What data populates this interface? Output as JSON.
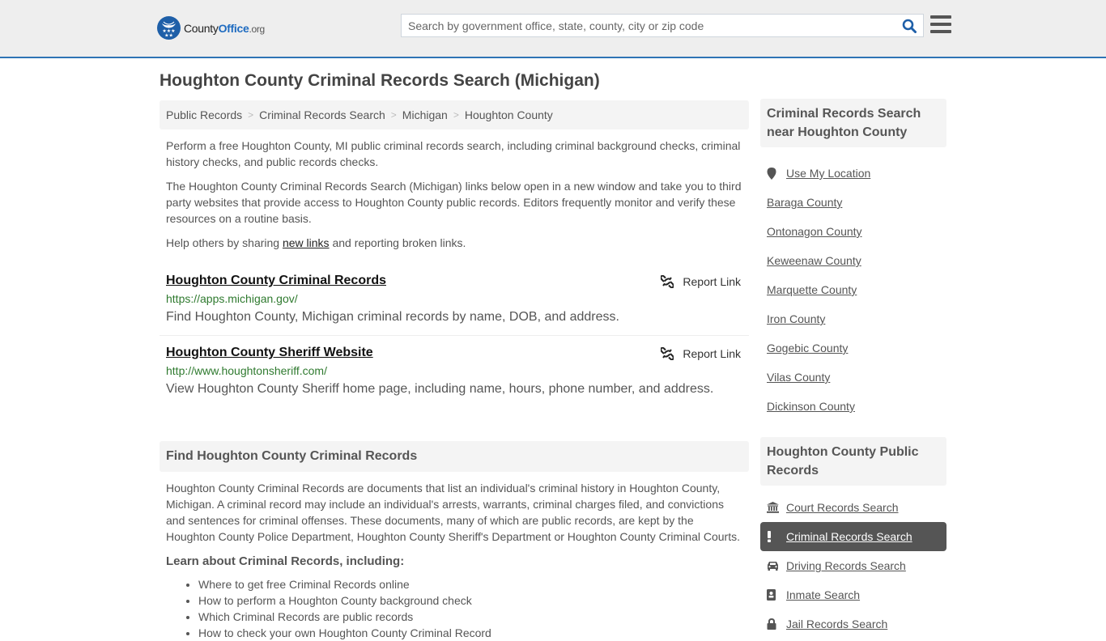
{
  "header": {
    "logo": {
      "brand_part1": "County",
      "brand_part2": "Office",
      "brand_suffix": ".org",
      "icon": "eagle-stars-badge-icon"
    },
    "search": {
      "placeholder": "Search by government office, state, county, city or zip code",
      "value": "",
      "icon": "search-icon"
    },
    "menu_icon": "hamburger-menu-icon"
  },
  "page": {
    "title": "Houghton County Criminal Records Search (Michigan)"
  },
  "breadcrumb": [
    {
      "label": "Public Records"
    },
    {
      "label": "Criminal Records Search"
    },
    {
      "label": "Michigan"
    },
    {
      "label": "Houghton County"
    }
  ],
  "breadcrumb_separator": ">",
  "intro": {
    "p1": "Perform a free Houghton County, MI public criminal records search, including criminal background checks, criminal history checks, and public records checks.",
    "p2": "The Houghton County Criminal Records Search (Michigan) links below open in a new window and take you to third party websites that provide access to Houghton County public records. Editors frequently monitor and verify these resources on a routine basis.",
    "p3_before": "Help others by sharing ",
    "p3_link": "new links",
    "p3_after": " and reporting broken links."
  },
  "links": [
    {
      "title": "Houghton County Criminal Records",
      "url": "https://apps.michigan.gov/",
      "description": "Find Houghton County, Michigan criminal records by name, DOB, and address.",
      "report_label": "Report Link"
    },
    {
      "title": "Houghton County Sheriff Website",
      "url": "http://www.houghtonsheriff.com/",
      "description": "View Houghton County Sheriff home page, including name, hours, phone number, and address.",
      "report_label": "Report Link"
    }
  ],
  "find_section": {
    "heading": "Find Houghton County Criminal Records",
    "body": "Houghton County Criminal Records are documents that list an individual's criminal history in Houghton County, Michigan. A criminal record may include an individual's arrests, warrants, criminal charges filed, and convictions and sentences for criminal offenses. These documents, many of which are public records, are kept by the Houghton County Police Department, Houghton County Sheriff's Department or Houghton County Criminal Courts.",
    "learn_heading": "Learn about Criminal Records, including:",
    "learn_items": [
      "Where to get free Criminal Records online",
      "How to perform a Houghton County background check",
      "Which Criminal Records are public records",
      "How to check your own Houghton County Criminal Record"
    ]
  },
  "sidebar": {
    "nearby": {
      "heading": "Criminal Records Search near Houghton County",
      "use_location": "Use My Location",
      "counties": [
        "Baraga County",
        "Ontonagon County",
        "Keweenaw County",
        "Marquette County",
        "Iron County",
        "Gogebic County",
        "Vilas County",
        "Dickinson County"
      ]
    },
    "public_records": {
      "heading": "Houghton County Public Records",
      "items": [
        {
          "label": "Court Records Search",
          "icon": "courthouse-icon",
          "active": false
        },
        {
          "label": "Criminal Records Search",
          "icon": "exclamation-icon",
          "active": true
        },
        {
          "label": "Driving Records Search",
          "icon": "car-icon",
          "active": false
        },
        {
          "label": "Inmate Search",
          "icon": "id-badge-icon",
          "active": false
        },
        {
          "label": "Jail Records Search",
          "icon": "lock-icon",
          "active": false
        }
      ]
    }
  },
  "colors": {
    "accent_blue": "#2e74b5",
    "logo_blue": "#1e5fa8",
    "url_green": "#2f7a2f",
    "active_item_bg": "#555555",
    "panel_bg": "#f4f4f4",
    "header_bg": "#eeeeee"
  }
}
